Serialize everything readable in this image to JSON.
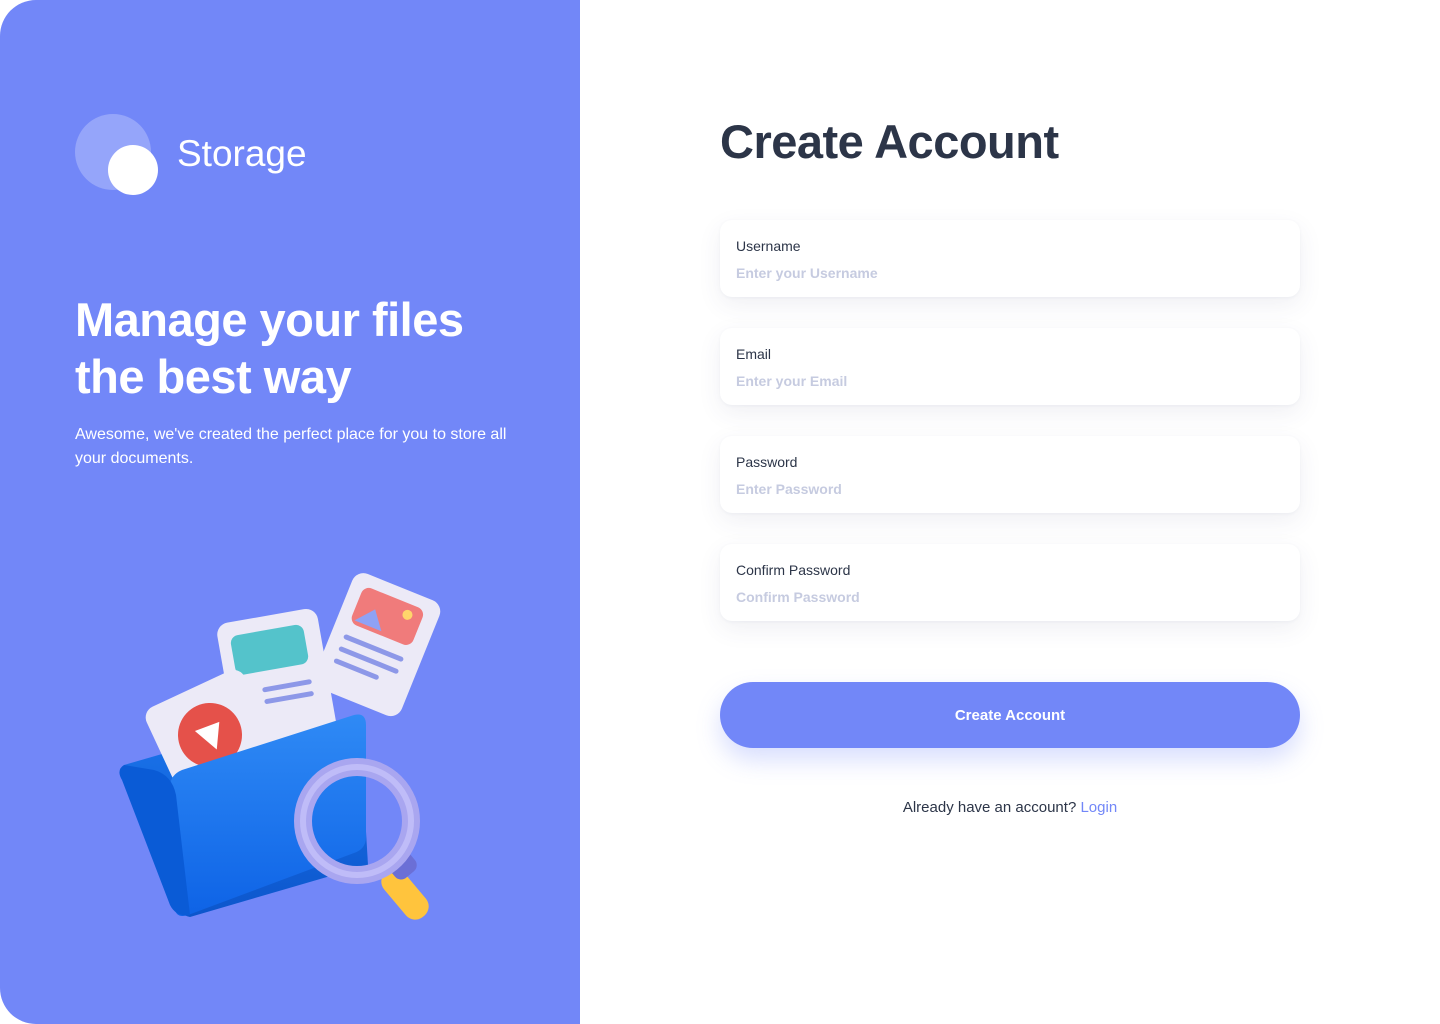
{
  "brand": {
    "name": "Storage"
  },
  "hero": {
    "headline_line1": "Manage your files",
    "headline_line2": "the best way",
    "subtitle": "Awesome, we've created the perfect place for you to store all your documents."
  },
  "form": {
    "title": "Create Account",
    "fields": [
      {
        "label": "Username",
        "placeholder": "Enter your Username",
        "value": ""
      },
      {
        "label": "Email",
        "placeholder": "Enter your Email",
        "value": ""
      },
      {
        "label": "Password",
        "placeholder": "Enter Password",
        "value": ""
      },
      {
        "label": "Confirm Password",
        "placeholder": "Confirm Password",
        "value": ""
      }
    ],
    "submit_label": "Create Account",
    "footer_text": "Already have an account?",
    "login_link": "Login"
  },
  "colors": {
    "accent": "#7287f8",
    "heading": "#2c3548",
    "placeholder": "#c6cbe0"
  }
}
